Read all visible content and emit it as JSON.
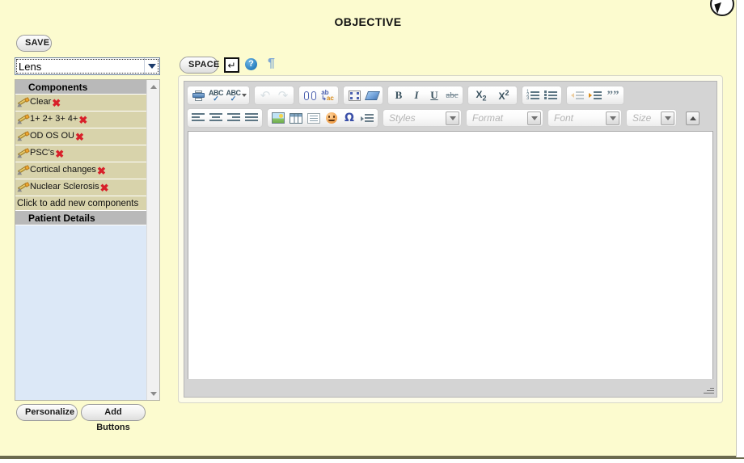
{
  "page": {
    "title": "OBJECTIVE",
    "background_color": "#fcfbcf"
  },
  "toolbar_left": {
    "save_label": "SAVE",
    "category_select": {
      "value": "Lens",
      "options": [
        "Lens"
      ]
    }
  },
  "components_panel": {
    "section_header": "Components",
    "items": [
      {
        "label": "Clear"
      },
      {
        "label": "1+ 2+ 3+ 4+"
      },
      {
        "label": "OD OS OU"
      },
      {
        "label": "PSC's"
      },
      {
        "label": "Cortical changes"
      },
      {
        "label": "Nuclear Sclerosis"
      }
    ],
    "add_new_label": "Click to add new components",
    "patient_details_header": "Patient Details"
  },
  "bottom_buttons": {
    "personalize": "Personalize",
    "add_buttons": "Add Buttons"
  },
  "editor_header": {
    "space_label": "SPACE",
    "enter_icon": "↵",
    "help_icon": "?",
    "pilcrow_icon": "¶"
  },
  "editor": {
    "content": "",
    "selects": {
      "styles": "Styles",
      "format": "Format",
      "font": "Font",
      "size": "Size"
    },
    "buttons_row1": [
      {
        "name": "print",
        "label": ""
      },
      {
        "name": "spell-check",
        "label": "ABC"
      },
      {
        "name": "spell-check-menu",
        "label": "ABC"
      },
      {
        "name": "undo",
        "label": "↶"
      },
      {
        "name": "redo",
        "label": "↷"
      },
      {
        "name": "find",
        "label": ""
      },
      {
        "name": "replace",
        "label": "ab ac"
      },
      {
        "name": "select-all",
        "label": ""
      },
      {
        "name": "remove-format",
        "label": ""
      },
      {
        "name": "bold",
        "label": "B"
      },
      {
        "name": "italic",
        "label": "I"
      },
      {
        "name": "underline",
        "label": "U"
      },
      {
        "name": "strikethrough",
        "label": "abc"
      },
      {
        "name": "subscript",
        "label": "X2"
      },
      {
        "name": "superscript",
        "label": "X2"
      },
      {
        "name": "numbered-list",
        "label": ""
      },
      {
        "name": "bulleted-list",
        "label": ""
      },
      {
        "name": "decrease-indent",
        "label": ""
      },
      {
        "name": "increase-indent",
        "label": ""
      },
      {
        "name": "blockquote",
        "label": "”"
      }
    ],
    "buttons_row2": [
      {
        "name": "align-left",
        "label": ""
      },
      {
        "name": "align-center",
        "label": ""
      },
      {
        "name": "align-right",
        "label": ""
      },
      {
        "name": "align-justify",
        "label": ""
      },
      {
        "name": "insert-image",
        "label": ""
      },
      {
        "name": "insert-table",
        "label": ""
      },
      {
        "name": "horizontal-rule",
        "label": ""
      },
      {
        "name": "insert-smiley",
        "label": ""
      },
      {
        "name": "special-character",
        "label": "Ω"
      },
      {
        "name": "page-break",
        "label": ""
      }
    ]
  },
  "colors": {
    "page_bg": "#fcfbcf",
    "component_row": "#d8d3ab",
    "section_header": "#b9b9b9",
    "patient_panel": "#dce8f7",
    "delete_x": "#d8202a",
    "editor_chrome": "#d4d4d4"
  }
}
